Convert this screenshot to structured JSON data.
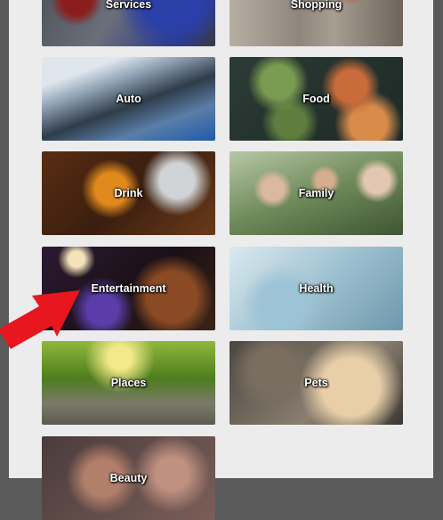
{
  "categories": [
    {
      "id": "services",
      "label": "Services"
    },
    {
      "id": "shopping",
      "label": "Shopping"
    },
    {
      "id": "auto",
      "label": "Auto"
    },
    {
      "id": "food",
      "label": "Food"
    },
    {
      "id": "drink",
      "label": "Drink"
    },
    {
      "id": "family",
      "label": "Family"
    },
    {
      "id": "entertainment",
      "label": "Entertainment"
    },
    {
      "id": "health",
      "label": "Health"
    },
    {
      "id": "places",
      "label": "Places"
    },
    {
      "id": "pets",
      "label": "Pets"
    },
    {
      "id": "beauty",
      "label": "Beauty"
    }
  ],
  "colors": {
    "arrow": "#e8161f",
    "panel": "#ececec",
    "backdrop": "#5a5a5a"
  },
  "annotation": {
    "icon": "pointer-arrow-icon"
  }
}
